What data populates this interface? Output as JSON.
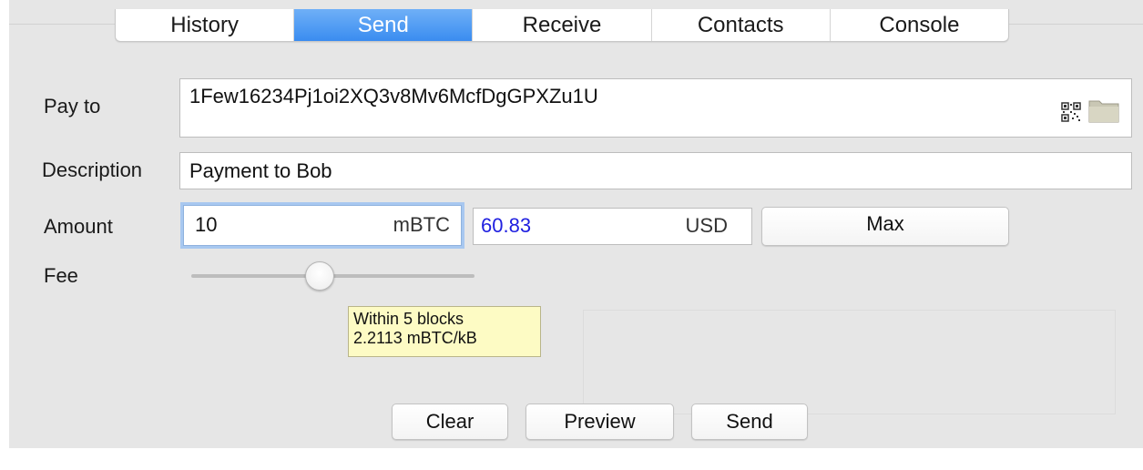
{
  "tabs": [
    {
      "label": "History"
    },
    {
      "label": "Send",
      "active": true
    },
    {
      "label": "Receive"
    },
    {
      "label": "Contacts"
    },
    {
      "label": "Console"
    }
  ],
  "form": {
    "pay_to_label": "Pay to",
    "pay_to_value": "1Few16234Pj1oi2XQ3v8Mv6McfDgGPXZu1U",
    "description_label": "Description",
    "description_value": "Payment to Bob",
    "amount_label": "Amount",
    "amount_value": "10",
    "amount_unit": "mBTC",
    "fiat_value": "60.83",
    "fiat_unit": "USD",
    "max_label": "Max",
    "fee_label": "Fee",
    "fee_slider_level": 0.5
  },
  "tooltip": {
    "line1": "Within 5 blocks",
    "line2": "2.2113 mBTC/kB"
  },
  "buttons": {
    "clear": "Clear",
    "preview": "Preview",
    "send": "Send"
  },
  "icons": {
    "qr": "qr-code-icon",
    "folder": "folder-icon"
  },
  "colors": {
    "active_tab": "#3a8cf0",
    "fiat_text": "#2020e0",
    "tooltip_bg": "#fdfbc4"
  }
}
